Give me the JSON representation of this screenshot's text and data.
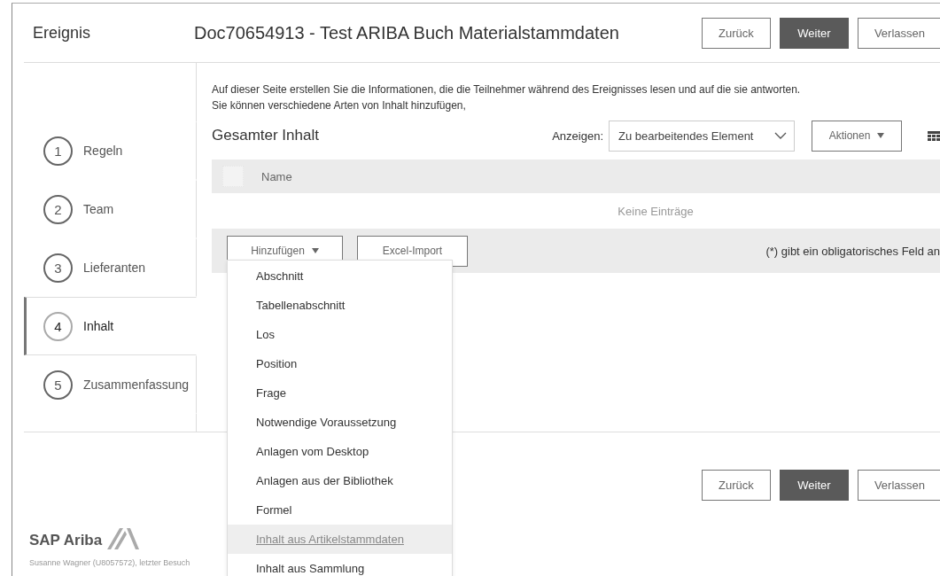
{
  "header": {
    "section": "Ereignis",
    "title": "Doc70654913 - Test ARIBA Buch Materialstammdaten",
    "buttons": [
      {
        "label": "Zurück",
        "primary": false
      },
      {
        "label": "Weiter",
        "primary": true
      },
      {
        "label": "Verlassen",
        "primary": false
      }
    ]
  },
  "steps": [
    {
      "number": "1",
      "label": "Regeln",
      "selected": false
    },
    {
      "number": "2",
      "label": "Team",
      "selected": false
    },
    {
      "number": "3",
      "label": "Lieferanten",
      "selected": false
    },
    {
      "number": "4",
      "label": "Inhalt",
      "selected": true
    },
    {
      "number": "5",
      "label": "Zusammenfassung",
      "selected": false
    }
  ],
  "intro_lines": [
    "Auf dieser Seite erstellen Sie die Informationen, die die Teilnehmer während des Ereignisses lesen und auf die sie antworten.",
    "Sie können verschiedene Arten von Inhalt hinzufügen,"
  ],
  "content": {
    "title": "Gesamter Inhalt",
    "filter": {
      "label": "Anzeigen:",
      "value": "Zu bearbeitendes Element"
    },
    "actions": "Aktionen",
    "table": {
      "select_all": {
        "checked": false
      },
      "columns": [
        "Name"
      ],
      "empty": "Keine Einträge"
    },
    "footer": {
      "add": "Hinzufügen",
      "import": "Excel-Import",
      "note": "(*) gibt ein obligatorisches Feld an"
    }
  },
  "menu": [
    {
      "label": "Abschnitt",
      "highlighted": false
    },
    {
      "label": "Tabellenabschnitt",
      "highlighted": false
    },
    {
      "label": "Los",
      "highlighted": false
    },
    {
      "label": "Position",
      "highlighted": false
    },
    {
      "label": "Frage",
      "highlighted": false
    },
    {
      "label": "Notwendige Voraussetzung",
      "highlighted": false
    },
    {
      "label": "Anlagen vom Desktop",
      "highlighted": false
    },
    {
      "label": "Anlagen aus der Bibliothek",
      "highlighted": false
    },
    {
      "label": "Formel",
      "highlighted": false
    },
    {
      "label": "Inhalt aus Artikelstammdaten",
      "highlighted": true
    },
    {
      "label": "Inhalt aus Sammlung",
      "highlighted": false
    }
  ],
  "bottom_buttons": [
    {
      "label": "Zurück",
      "primary": false
    },
    {
      "label": "Weiter",
      "primary": true
    },
    {
      "label": "Verlassen",
      "primary": false
    }
  ],
  "logo": "SAP Ariba",
  "user": "Susanne Wagner (U8057572), letzter Besuch"
}
